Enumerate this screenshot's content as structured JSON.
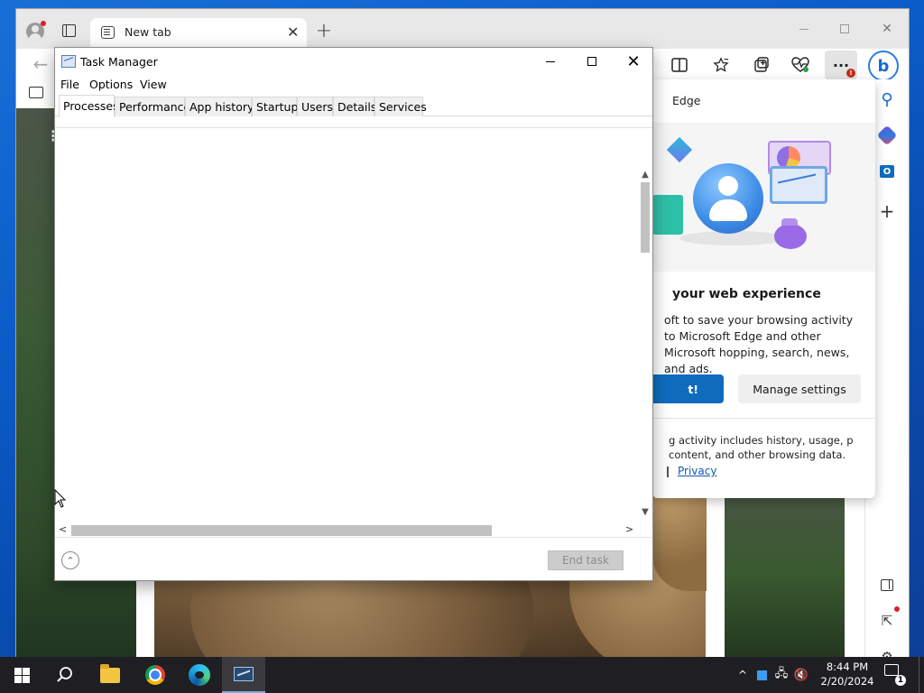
{
  "edge": {
    "tab_title": "New tab",
    "tab_close": "✕",
    "new_tab_glyph": "+",
    "back_glyph": "←",
    "more_glyph": "···",
    "more_badge": "!",
    "icons": {
      "profile": "profile-icon",
      "tab_actions": "tab-actions-icon",
      "split_screen": "split-screen-icon",
      "favorites": "favorites-star-icon",
      "collections": "collections-icon",
      "browser_essentials": "browser-essentials-icon",
      "copilot": "copilot-icon"
    },
    "sidebar": {
      "search_glyph": "⚲",
      "add_glyph": "+",
      "external_glyph": "⇱",
      "settings_glyph": "⚙",
      "outlook_letter": "O"
    },
    "flyout": {
      "title": "Edge",
      "heading": "your web experience",
      "body": "oft to save your browsing activity to Microsoft Edge and other Microsoft hopping, search, news, and ads.",
      "primary_button": "t!",
      "manage_button": "Manage settings",
      "footer": "g activity includes history, usage, p content, and other browsing data.",
      "privacy_link": "Privacy"
    },
    "page": {
      "kebab": "⋮"
    }
  },
  "taskmgr": {
    "title": "Task Manager",
    "menu": [
      "File",
      "Options",
      "View"
    ],
    "tabs": [
      "Processes",
      "Performance",
      "App history",
      "Startup",
      "Users",
      "Details",
      "Services"
    ],
    "active_tab": "Processes",
    "end_task": "End task",
    "fewer_details_glyph": "⌃",
    "close_glyph": "✕",
    "scroll": {
      "up": "▲",
      "down": "▼",
      "left": "<",
      "right": ">"
    }
  },
  "taskbar": {
    "search_glyph": "○",
    "tray": {
      "chevron": "^",
      "network": "🖧",
      "volume": "🔇"
    },
    "time": "8:44 PM",
    "date": "2/20/2024",
    "notification_count": "1"
  },
  "colors": {
    "desktop": "#0b5cc8",
    "edge_accent": "#0f6cbd",
    "taskbar": "#1f1f23"
  }
}
